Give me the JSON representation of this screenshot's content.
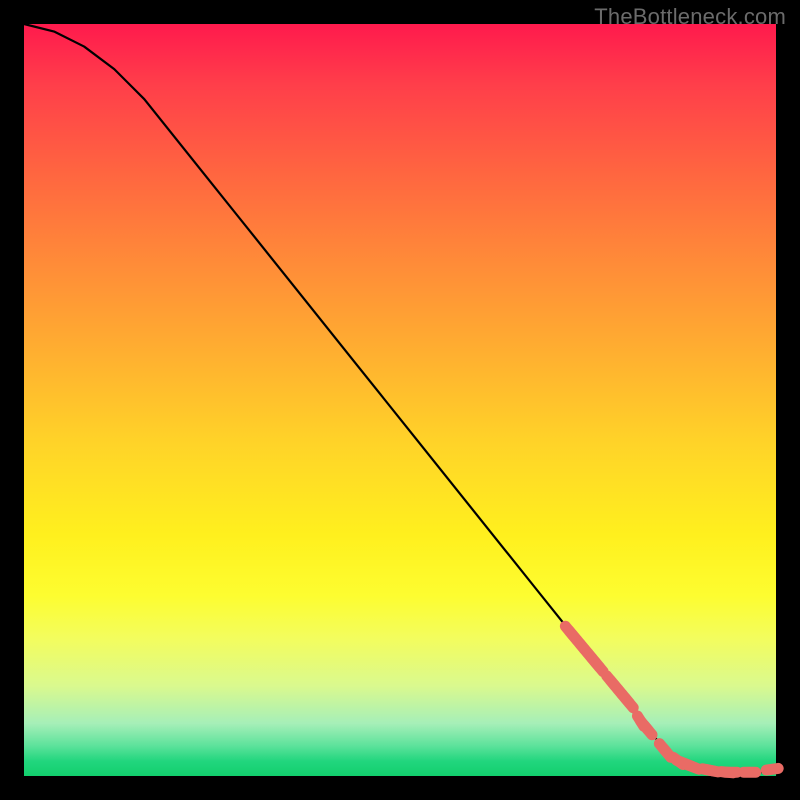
{
  "watermark": "TheBottleneck.com",
  "colors": {
    "background": "#000000",
    "watermark": "#6b6b6b",
    "curve": "#000000",
    "marker": "#e96b65"
  },
  "chart_data": {
    "type": "line",
    "title": "",
    "xlabel": "",
    "ylabel": "",
    "xlim": [
      0,
      100
    ],
    "ylim": [
      0,
      100
    ],
    "grid": false,
    "legend": false,
    "series": [
      {
        "name": "bottleneck-curve",
        "x": [
          0,
          4,
          8,
          12,
          16,
          20,
          24,
          28,
          32,
          36,
          40,
          44,
          48,
          52,
          56,
          60,
          64,
          68,
          72,
          76,
          80,
          82,
          84,
          86,
          88,
          90,
          92,
          94,
          96,
          98,
          100
        ],
        "y": [
          100,
          99,
          97,
          94,
          90,
          85,
          80,
          75,
          70,
          65,
          60,
          55,
          50,
          45,
          40,
          35,
          30,
          25,
          20,
          15,
          10,
          7,
          5,
          3,
          2,
          1,
          0.5,
          0.3,
          0.3,
          0.5,
          1
        ]
      }
    ],
    "highlighted_points": {
      "name": "highlighted-range",
      "x": [
        72.5,
        73.0,
        73.5,
        74.0,
        74.5,
        75.0,
        75.5,
        76.0,
        76.5,
        78.0,
        78.5,
        79.0,
        79.5,
        80.0,
        80.5,
        82.0,
        82.5,
        83.0,
        85.0,
        85.5,
        87.0,
        87.5,
        88.0,
        88.5,
        89.0,
        91.0,
        91.5,
        93.5,
        94.0,
        96.5,
        99.5
      ],
      "y": [
        19.3,
        18.7,
        18.1,
        17.5,
        16.9,
        16.3,
        15.7,
        15.1,
        14.5,
        12.7,
        12.1,
        11.5,
        10.9,
        10.3,
        9.7,
        7.3,
        6.7,
        6.1,
        3.7,
        3.1,
        2.0,
        1.8,
        1.6,
        1.4,
        1.2,
        0.8,
        0.7,
        0.5,
        0.5,
        0.5,
        0.9
      ]
    }
  }
}
